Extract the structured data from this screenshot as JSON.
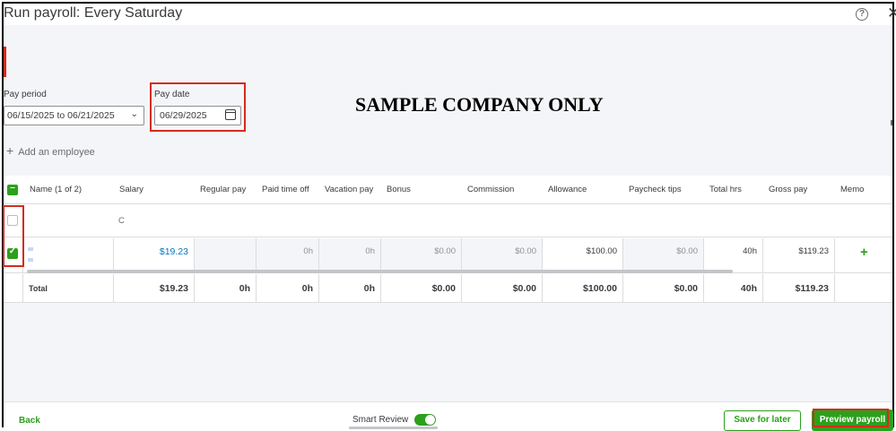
{
  "header": {
    "title": "Run payroll: Every Saturday"
  },
  "pay_period": {
    "label": "Pay period",
    "value": "06/15/2025 to 06/21/2025"
  },
  "pay_date": {
    "label": "Pay date",
    "value": "06/29/2025"
  },
  "watermark": "SAMPLE COMPANY ONLY",
  "add_employee": "Add an employee",
  "table": {
    "headers": [
      "Name (1 of 2)",
      "Salary",
      "Regular pay",
      "Paid time off",
      "Vacation pay",
      "Bonus",
      "Commission",
      "Allowance",
      "Paycheck tips",
      "Total hrs",
      "Gross pay",
      "Memo"
    ],
    "filter_row": {
      "salary_fragment": "C"
    },
    "employee_row": {
      "salary": "$19.23",
      "regular_pay": "",
      "paid_time_off": "0h",
      "vacation_pay": "0h",
      "bonus": "$0.00",
      "commission": "$0.00",
      "allowance": "$100.00",
      "paycheck_tips": "$0.00",
      "total_hrs": "40h",
      "gross_pay": "$119.23",
      "memo_add": "+"
    },
    "total_row": {
      "label": "Total",
      "salary": "$19.23",
      "regular_pay": "0h",
      "paid_time_off": "0h",
      "vacation_pay": "0h",
      "bonus": "$0.00",
      "commission": "$0.00",
      "allowance": "$100.00",
      "paycheck_tips": "$0.00",
      "total_hrs": "40h",
      "gross_pay": "$119.23"
    }
  },
  "footer": {
    "back": "Back",
    "smart_review": "Smart Review",
    "save_later": "Save for later",
    "preview": "Preview payroll"
  },
  "colors": {
    "accent": "#2ca01c",
    "highlight": "#d52b1e"
  }
}
